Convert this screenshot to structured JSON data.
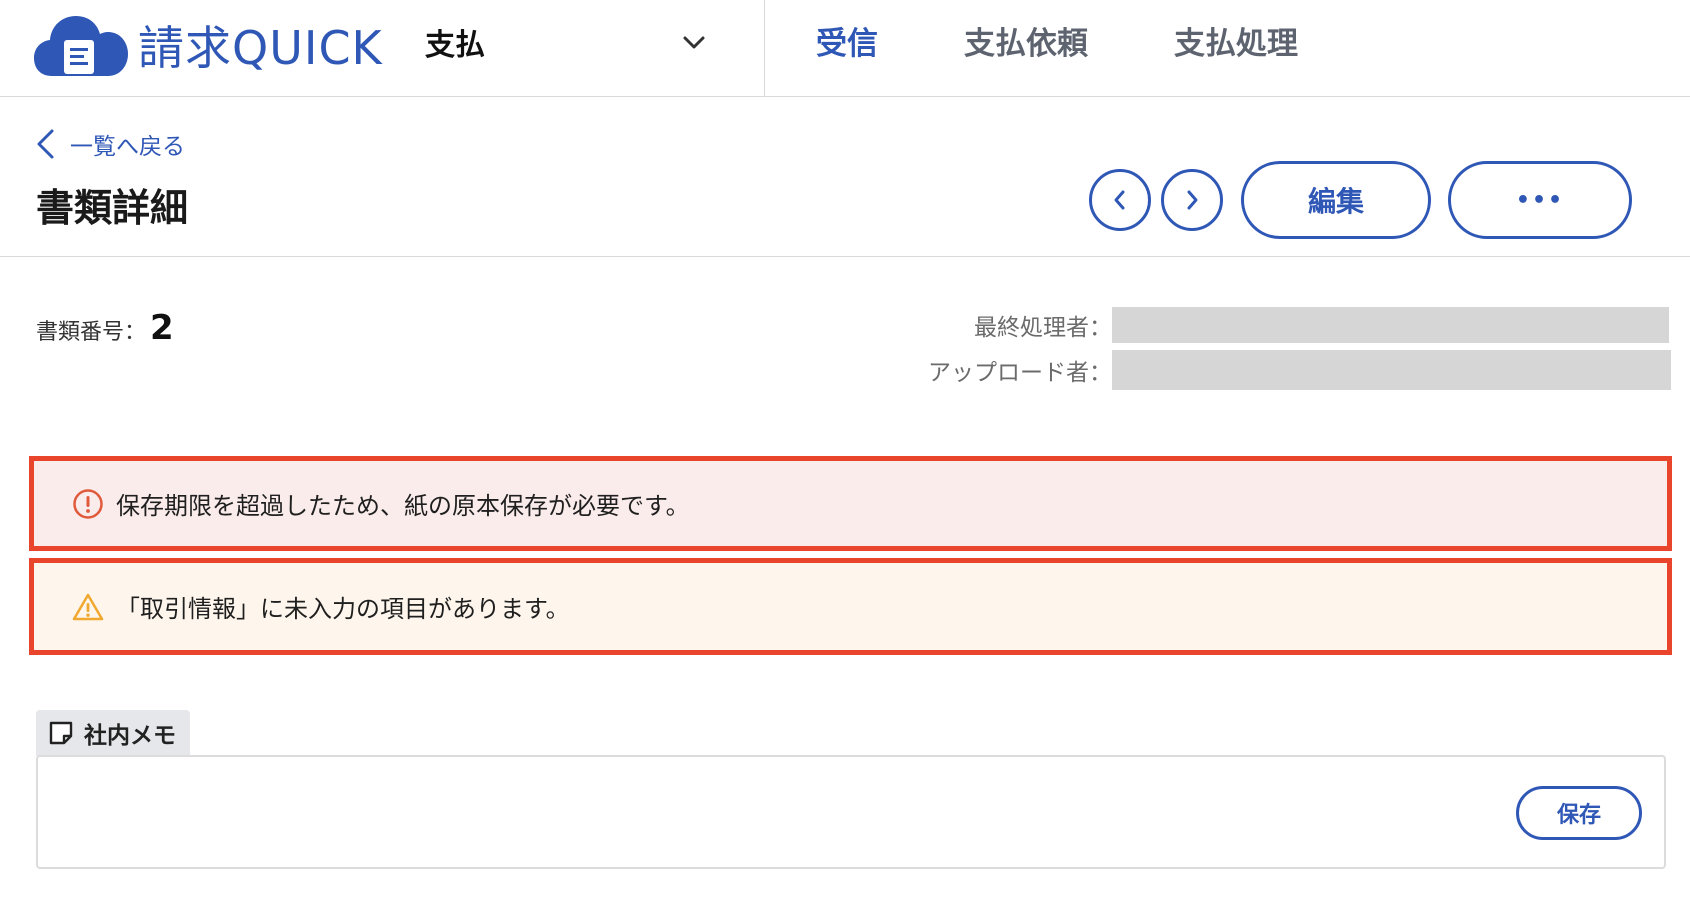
{
  "header": {
    "logo_text": "請求QUICK",
    "switcher_label": "支払",
    "nav": [
      {
        "label": "受信",
        "active": true
      },
      {
        "label": "支払依頼",
        "active": false
      },
      {
        "label": "支払処理",
        "active": false
      }
    ]
  },
  "title_area": {
    "back_label": "一覧へ戻る",
    "page_title": "書類詳細",
    "edit_label": "編集",
    "more_label": "•••"
  },
  "meta": {
    "doc_number_label": "書類番号：",
    "doc_number_value": "2",
    "last_processor_label": "最終処理者：",
    "uploader_label": "アップロード者："
  },
  "alerts": {
    "error_text": "保存期限を超過したため、紙の原本保存が必要です。",
    "warning_text": "「取引情報」に未入力の項目があります。"
  },
  "memo": {
    "tab_label": "社内メモ",
    "value": "",
    "save_label": "保存"
  },
  "colors": {
    "brand": "#2f57b6",
    "alert_border": "#e8452c",
    "error_bg": "#fbecec",
    "warning_bg": "#fef6ec",
    "error_icon": "#e05a3c",
    "warning_icon": "#f0a830"
  }
}
